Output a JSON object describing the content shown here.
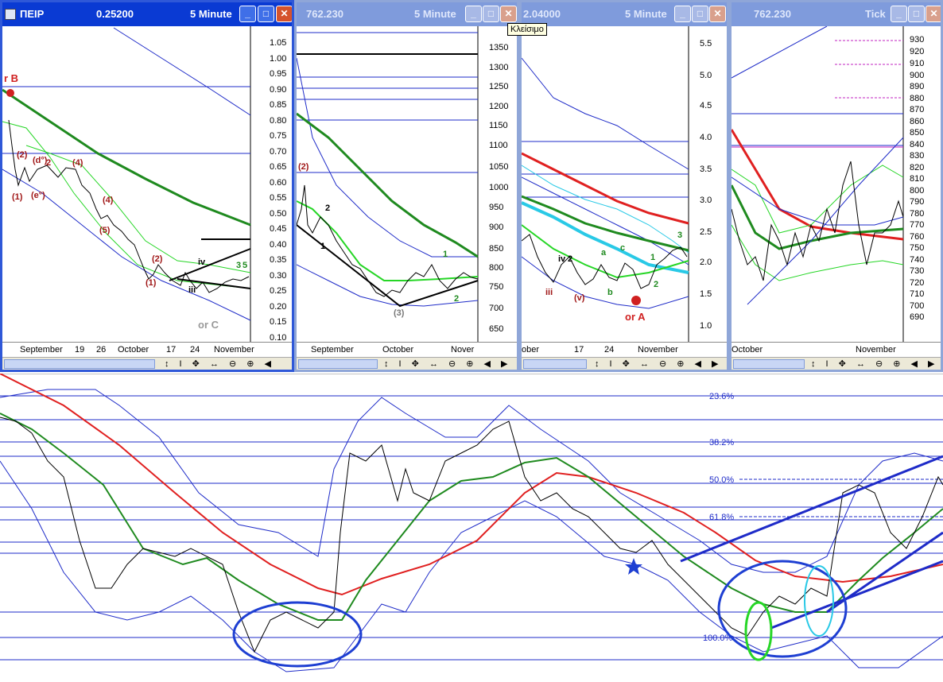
{
  "windows": [
    {
      "symbol": "ΠΕΙΡ",
      "value": "0.25200",
      "period": "5 Minute",
      "axis": [
        "1.05",
        "1.00",
        "0.95",
        "0.90",
        "0.85",
        "0.80",
        "0.75",
        "0.70",
        "0.65",
        "0.60",
        "0.55",
        "0.50",
        "0.45",
        "0.40",
        "0.35",
        "0.30",
        "0.25",
        "0.20",
        "0.15",
        "0.10"
      ],
      "dates": [
        "September",
        "19",
        "26",
        "October",
        "17",
        "24",
        "November"
      ],
      "labels": [
        "r B",
        "or C",
        "(2)",
        "(d°)",
        "2",
        "(4)",
        "(e°)",
        "(1)",
        "(4)",
        "(5)",
        "(2)",
        "iv",
        "iii",
        "(1)",
        "3",
        "5"
      ]
    },
    {
      "symbol": "",
      "value": "762.230",
      "period": "5 Minute",
      "axis": [
        "1350",
        "1300",
        "1250",
        "1200",
        "1150",
        "1100",
        "1050",
        "1000",
        "950",
        "900",
        "850",
        "800",
        "750",
        "700",
        "650"
      ],
      "dates": [
        "September",
        "October",
        "Nover"
      ],
      "labels": [
        "(2)",
        "2",
        "1",
        "(3)",
        "1",
        "2"
      ]
    },
    {
      "symbol": "",
      "value": "2.04000",
      "period": "5 Minute",
      "axis": [
        "5.5",
        "5.0",
        "4.5",
        "4.0",
        "3.5",
        "3.0",
        "2.5",
        "2.0",
        "1.5",
        "1.0"
      ],
      "dates": [
        "ober",
        "17",
        "24",
        "November"
      ],
      "labels": [
        "iii",
        "iv",
        "2",
        "(v)",
        "a",
        "b",
        "c",
        "1",
        "2",
        "3",
        "or A"
      ]
    },
    {
      "symbol": "",
      "value": "762.230",
      "period": "Tick",
      "axis": [
        "930",
        "920",
        "910",
        "900",
        "890",
        "880",
        "870",
        "860",
        "850",
        "840",
        "830",
        "820",
        "810",
        "800",
        "790",
        "780",
        "770",
        "760",
        "750",
        "740",
        "730",
        "720",
        "710",
        "700",
        "690"
      ],
      "dates": [
        "October",
        "November"
      ],
      "labels": []
    }
  ],
  "tooltip": "Κλείσιμο",
  "toolbar_tools": "↕ I ✥ ↔ ⊖ ⊕ ◀ ▶ ▭",
  "fib_levels": [
    "23.6%",
    "38.2%",
    "50.0%",
    "61.8%",
    "100.0%"
  ],
  "colors": {
    "title_active": "#0a3ad3",
    "price": "#000000",
    "ma_green": "#1f8a1f",
    "ma_red": "#e02020",
    "band_blue": "#1e2bc8",
    "highlight_blue": "#1e3fd2",
    "highlight_green": "#26d626",
    "highlight_cyan": "#29c9e6"
  }
}
